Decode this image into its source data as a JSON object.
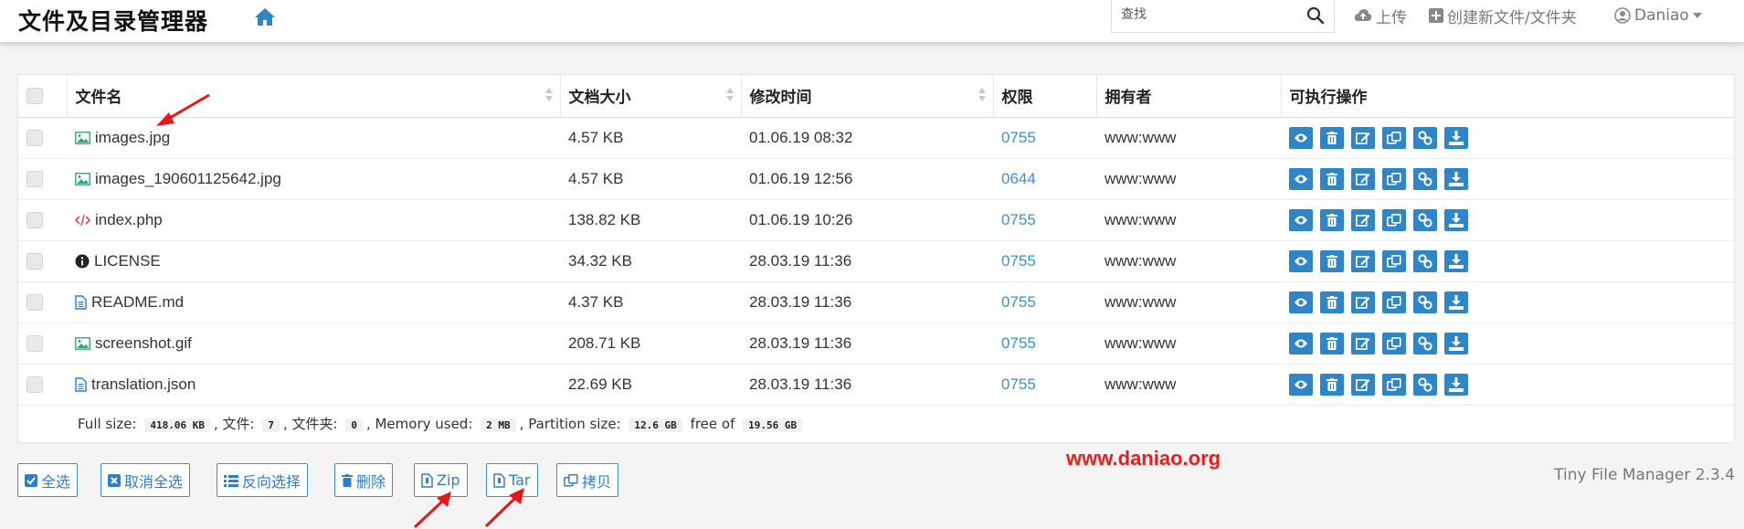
{
  "header": {
    "brand": "文件及目录管理器",
    "search_placeholder": "查找",
    "upload_label": "上传",
    "create_label": "创建新文件/文件夹",
    "user_label": "Daniao"
  },
  "table": {
    "columns": [
      "文件名",
      "文档大小",
      "修改时间",
      "权限",
      "拥有者",
      "可执行操作"
    ],
    "rows": [
      {
        "name": "images.jpg",
        "icon": "image-icon",
        "size": "4.57 KB",
        "modified": "01.06.19 08:32",
        "perms": "0755",
        "owner": "www:www"
      },
      {
        "name": "images_190601125642.jpg",
        "icon": "image-icon",
        "size": "4.57 KB",
        "modified": "01.06.19 12:56",
        "perms": "0644",
        "owner": "www:www"
      },
      {
        "name": "index.php",
        "icon": "code-icon",
        "size": "138.82 KB",
        "modified": "01.06.19 10:26",
        "perms": "0755",
        "owner": "www:www"
      },
      {
        "name": "LICENSE",
        "icon": "info-icon",
        "size": "34.32 KB",
        "modified": "28.03.19 11:36",
        "perms": "0755",
        "owner": "www:www"
      },
      {
        "name": "README.md",
        "icon": "document-icon",
        "size": "4.37 KB",
        "modified": "28.03.19 11:36",
        "perms": "0755",
        "owner": "www:www"
      },
      {
        "name": "screenshot.gif",
        "icon": "image-icon",
        "size": "208.71 KB",
        "modified": "28.03.19 11:36",
        "perms": "0755",
        "owner": "www:www"
      },
      {
        "name": "translation.json",
        "icon": "document-icon",
        "size": "22.69 KB",
        "modified": "28.03.19 11:36",
        "perms": "0755",
        "owner": "www:www"
      }
    ],
    "action_icons": [
      "eye-icon",
      "trash-icon",
      "edit-icon",
      "copy-icon",
      "link-icon",
      "download-icon"
    ]
  },
  "summary": {
    "full_size_label": "Full size:",
    "full_size": "418.06 KB",
    "files_label": ", 文件:",
    "files": "7",
    "folders_label": ", 文件夹:",
    "folders": "0",
    "memory_label": ", Memory used:",
    "memory": "2 MB",
    "partition_label": ", Partition size:",
    "partition": "12.6 GB",
    "free_label": "free of",
    "free": "19.56 GB"
  },
  "buttons": {
    "select_all": "全选",
    "unselect_all": "取消全选",
    "invert": "反向选择",
    "delete": "删除",
    "zip": "Zip",
    "tar": "Tar",
    "copy": "拷贝"
  },
  "watermark": "www.daniao.org",
  "version": "Tiny File Manager 2.3.4",
  "colors": {
    "accent": "#2e86c8",
    "link": "#3d8fd8",
    "annotation": "#ea1d1d"
  }
}
